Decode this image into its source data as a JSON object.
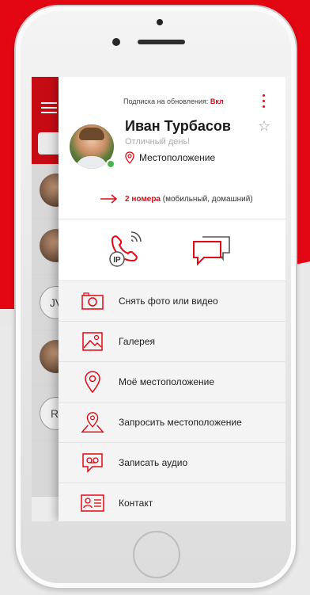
{
  "profile": {
    "subscription_label": "Подписка на обновления:",
    "subscription_value": "Вкл",
    "name": "Иван Турбасов",
    "status": "Отличный день!",
    "location": "Местоположение",
    "numbers_count": "2 номера",
    "numbers_types": "(мобильный, домашний)"
  },
  "underlying_list": {
    "initials_1": "JV",
    "initials_2": "RI"
  },
  "menu": {
    "items": [
      {
        "label": "Снять фото или видео",
        "icon": "camera-icon"
      },
      {
        "label": "Галерея",
        "icon": "gallery-icon"
      },
      {
        "label": "Моё местоположение",
        "icon": "location-pin-icon"
      },
      {
        "label": "Запросить местоположение",
        "icon": "request-location-icon"
      },
      {
        "label": "Записать аудио",
        "icon": "audio-record-icon"
      },
      {
        "label": "Контакт",
        "icon": "contact-card-icon"
      }
    ]
  },
  "actions": {
    "ip_call_badge": "IP"
  },
  "colors": {
    "accent": "#e30613",
    "online": "#4caf50"
  }
}
